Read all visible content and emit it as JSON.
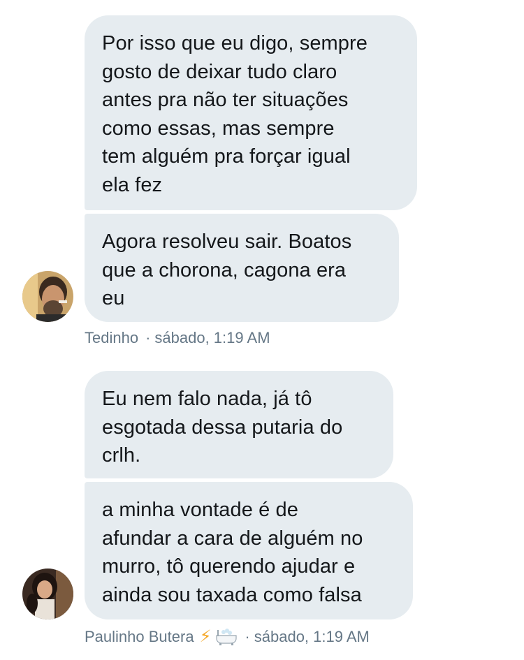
{
  "conversation": {
    "group1": {
      "messages": [
        "Por isso que eu digo, sempre\ngosto de deixar tudo claro\nantes pra não ter situações\ncomo essas, mas sempre\ntem alguém pra forçar igual\nela fez",
        "Agora resolveu sair. Boatos\nque a chorona, cagona era\neu"
      ],
      "sender": "Tedinho",
      "separator": "·",
      "time": "sábado, 1:19 AM"
    },
    "group2": {
      "messages": [
        "Eu nem falo nada, já tô\nesgotada dessa putaria do\ncrlh.",
        "a minha vontade é de\nafundar a cara de alguém no\nmurro, tô querendo ajudar e\nainda sou taxada como falsa"
      ],
      "sender": "Paulinho Butera",
      "sender_emoji_bolt": "⚡",
      "sender_emoji_bath": "bathtub-emoji",
      "separator": "·",
      "time": "sábado, 1:19 AM"
    }
  },
  "colors": {
    "bubble_bg": "#e6ecf0",
    "text": "#14171a",
    "meta_text": "#657786"
  }
}
